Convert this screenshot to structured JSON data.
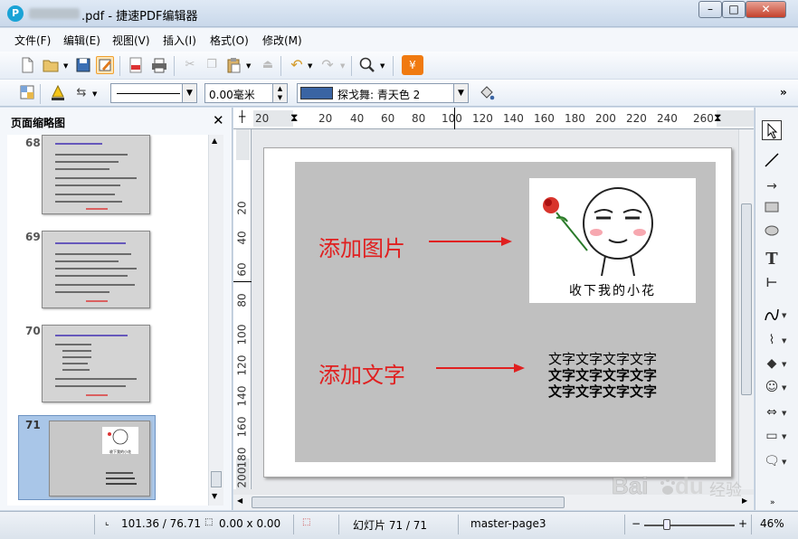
{
  "window": {
    "title": ".pdf - 捷速PDF编辑器",
    "icon_letter": "P",
    "controls": [
      "–",
      "□",
      "✕"
    ]
  },
  "menu": [
    "文件(F)",
    "编辑(E)",
    "视图(V)",
    "插入(I)",
    "格式(O)",
    "修改(M)"
  ],
  "toolbar2": {
    "line_width": "0.00毫米",
    "fill_color_label": "探戈舞: 青天色 2",
    "fill_color": "#3a64a3",
    "more": "»"
  },
  "sidepanel": {
    "title": "页面缩略图",
    "close": "✕",
    "pages": [
      {
        "number": "68"
      },
      {
        "number": "69"
      },
      {
        "number": "70"
      },
      {
        "number": "71",
        "selected": true
      }
    ],
    "thumb_caption": "收下我的小花"
  },
  "rulers": {
    "horizontal": [
      "20",
      "20",
      "40",
      "60",
      "80",
      "100",
      "120",
      "140",
      "160",
      "180",
      "200",
      "220",
      "240",
      "260"
    ],
    "vertical": [
      "20",
      "40",
      "60",
      "80",
      "100",
      "120",
      "140",
      "160",
      "180",
      "200"
    ]
  },
  "slide": {
    "label_image": "添加图片",
    "label_text": "添加文字",
    "image_caption": "收下我的小花",
    "text_lines": [
      "文字文字文字文字",
      "文字文字文字文字",
      "文字文字文字文字"
    ],
    "accent": "#e02020",
    "background": "#c0c0c0"
  },
  "status": {
    "position": "101.36 / 76.71",
    "size": "0.00 x 0.00",
    "slide": "幻灯片 71 / 71",
    "master": "master-page3",
    "zoom_minus": "−",
    "zoom_plus": "+",
    "zoom": "46%",
    "zoom_slider_fraction": 0.25
  },
  "watermark": {
    "brand": "Bai",
    "brand2": "du",
    "suffix": "经验"
  }
}
